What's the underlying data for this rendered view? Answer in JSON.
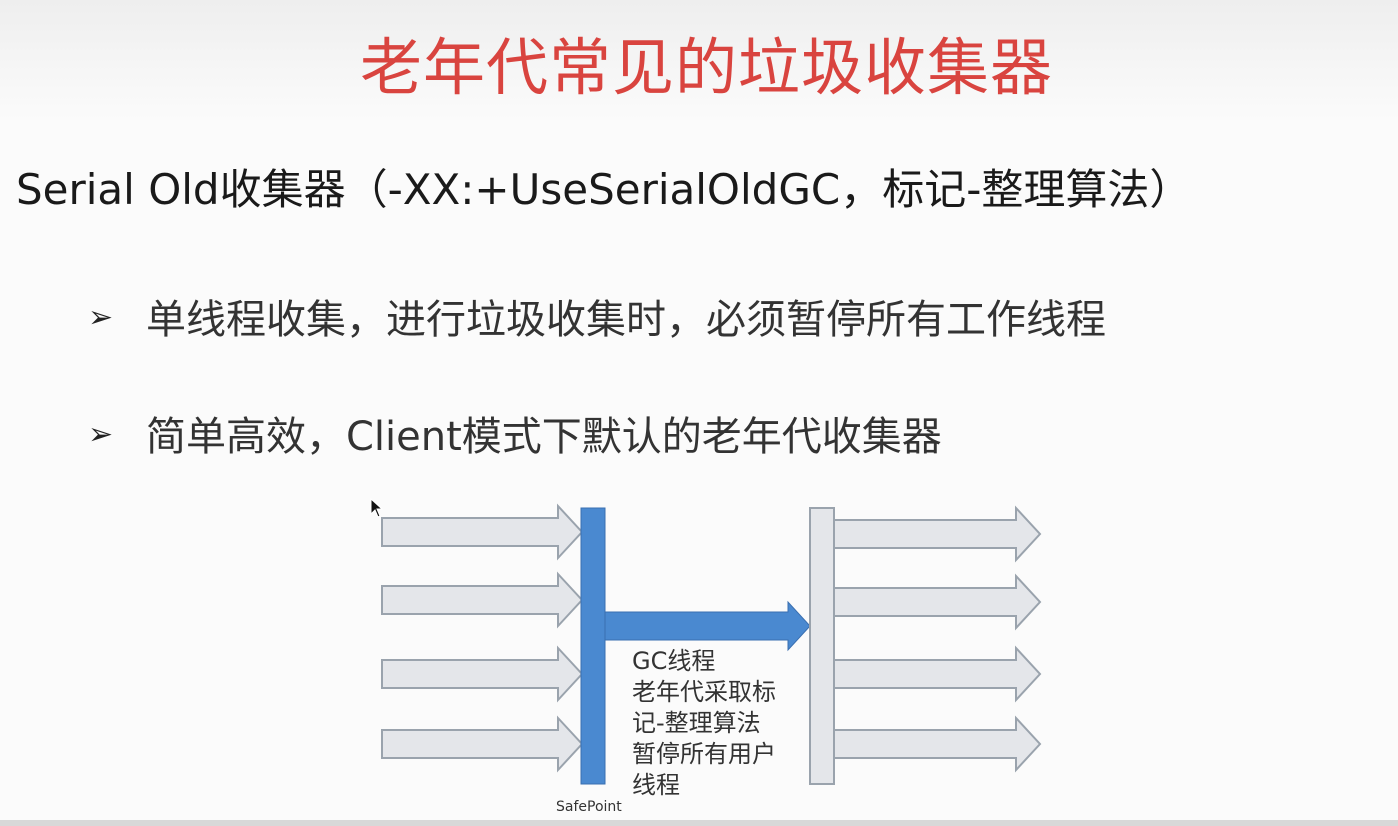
{
  "slide": {
    "title": "老年代常见的垃圾收集器",
    "subtitle": "Serial Old收集器（-XX:+UseSerialOldGC，标记-整理算法）",
    "bullets": [
      {
        "marker": "➢",
        "text": "单线程收集，进行垃圾收集时，必须暂停所有工作线程"
      },
      {
        "marker": "➢",
        "text": "简单高效，Client模式下默认的老年代收集器"
      }
    ]
  },
  "diagram": {
    "gc_label": "GC线程\n老年代采取标\n记-整理算法\n暂停所有用户\n线程",
    "safepoint_label": "SafePoint",
    "colors": {
      "user_thread_fill": "#e4e6ea",
      "user_thread_stroke": "#9aa3ad",
      "gc_blue": "#4a89d0",
      "light_bar": "#e4e6ea"
    },
    "left_arrow_count": 4,
    "right_arrow_count": 4
  }
}
